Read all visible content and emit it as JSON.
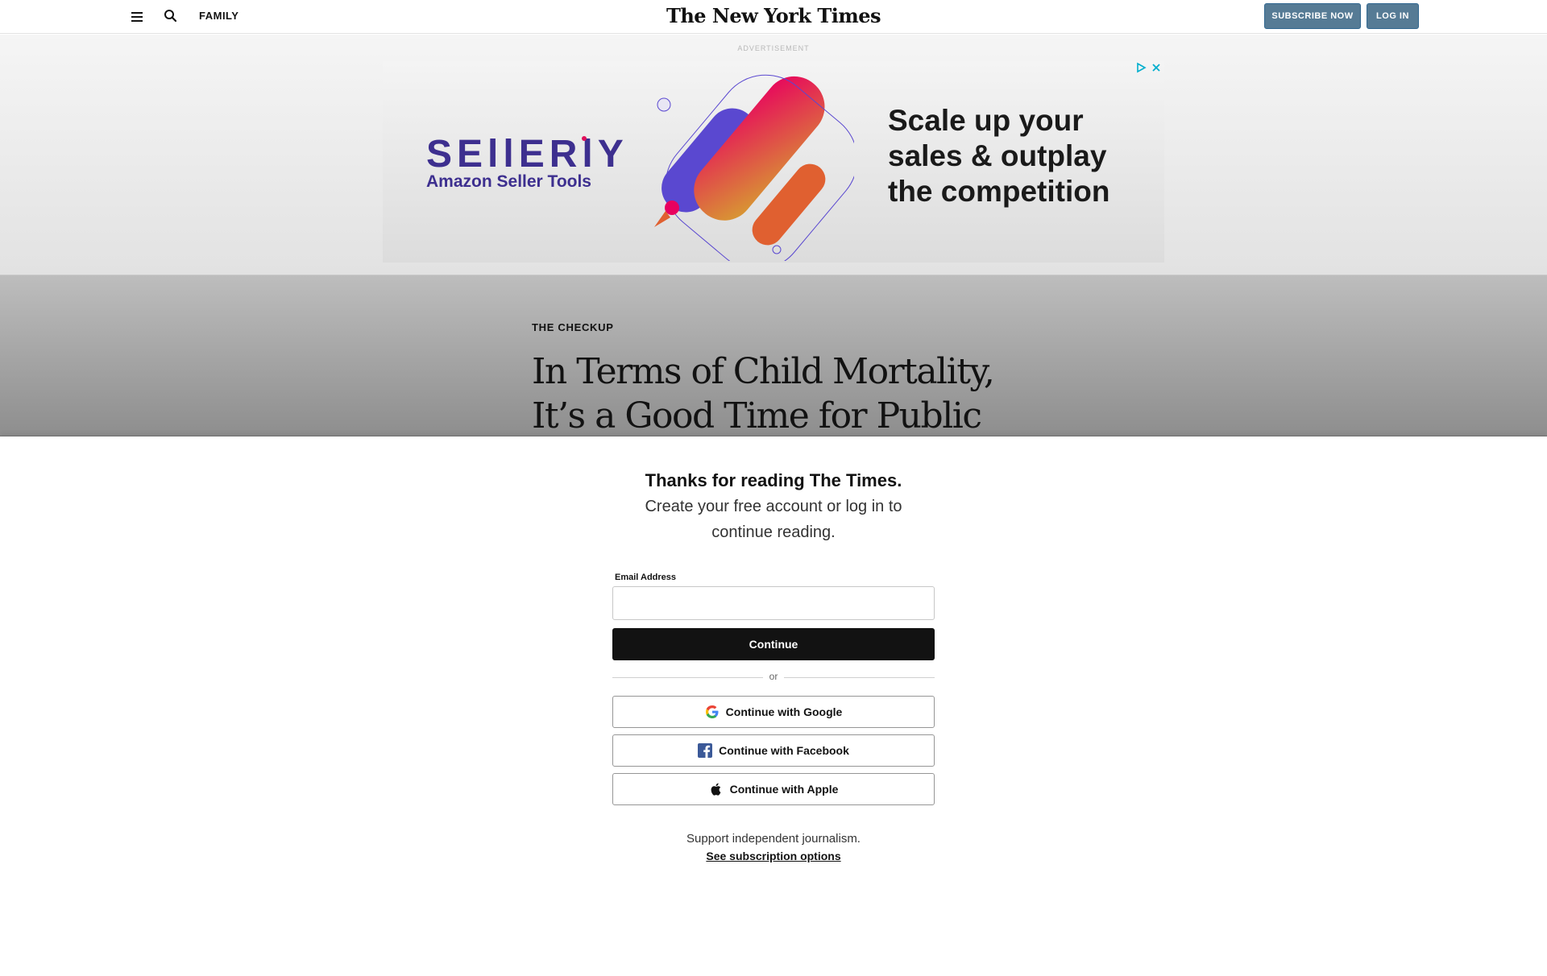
{
  "nav": {
    "section": "FAMILY",
    "logo": "The New York Times",
    "subscribe_label": "SUBSCRIBE NOW",
    "login_label": "LOG IN"
  },
  "ad": {
    "label": "ADVERTISEMENT",
    "brand": "SEllERlY",
    "brand_tagline": "Amazon Seller Tools",
    "headline": "Scale up your sales & outplay the competition"
  },
  "article": {
    "kicker": "THE CHECKUP",
    "headline": "In Terms of Child Mortality, It’s a Good Time for Public Health"
  },
  "regwall": {
    "title": "Thanks for reading The Times.",
    "subtitle": "Create your free account or log in to continue reading.",
    "email_label": "Email Address",
    "email_value": "",
    "continue_label": "Continue",
    "divider_text": "or",
    "google_label": "Continue with Google",
    "facebook_label": "Continue with Facebook",
    "apple_label": "Continue with Apple",
    "support_text": "Support independent journalism.",
    "subscription_link": "See subscription options"
  },
  "colors": {
    "subscribe_bg": "#567b95",
    "ad_brand": "#3d2f8f",
    "facebook_blue": "#3b5998"
  },
  "icons": [
    "hamburger-menu-icon",
    "search-icon",
    "ad-choices-icon",
    "ad-close-icon",
    "google-icon",
    "facebook-icon",
    "apple-icon"
  ]
}
